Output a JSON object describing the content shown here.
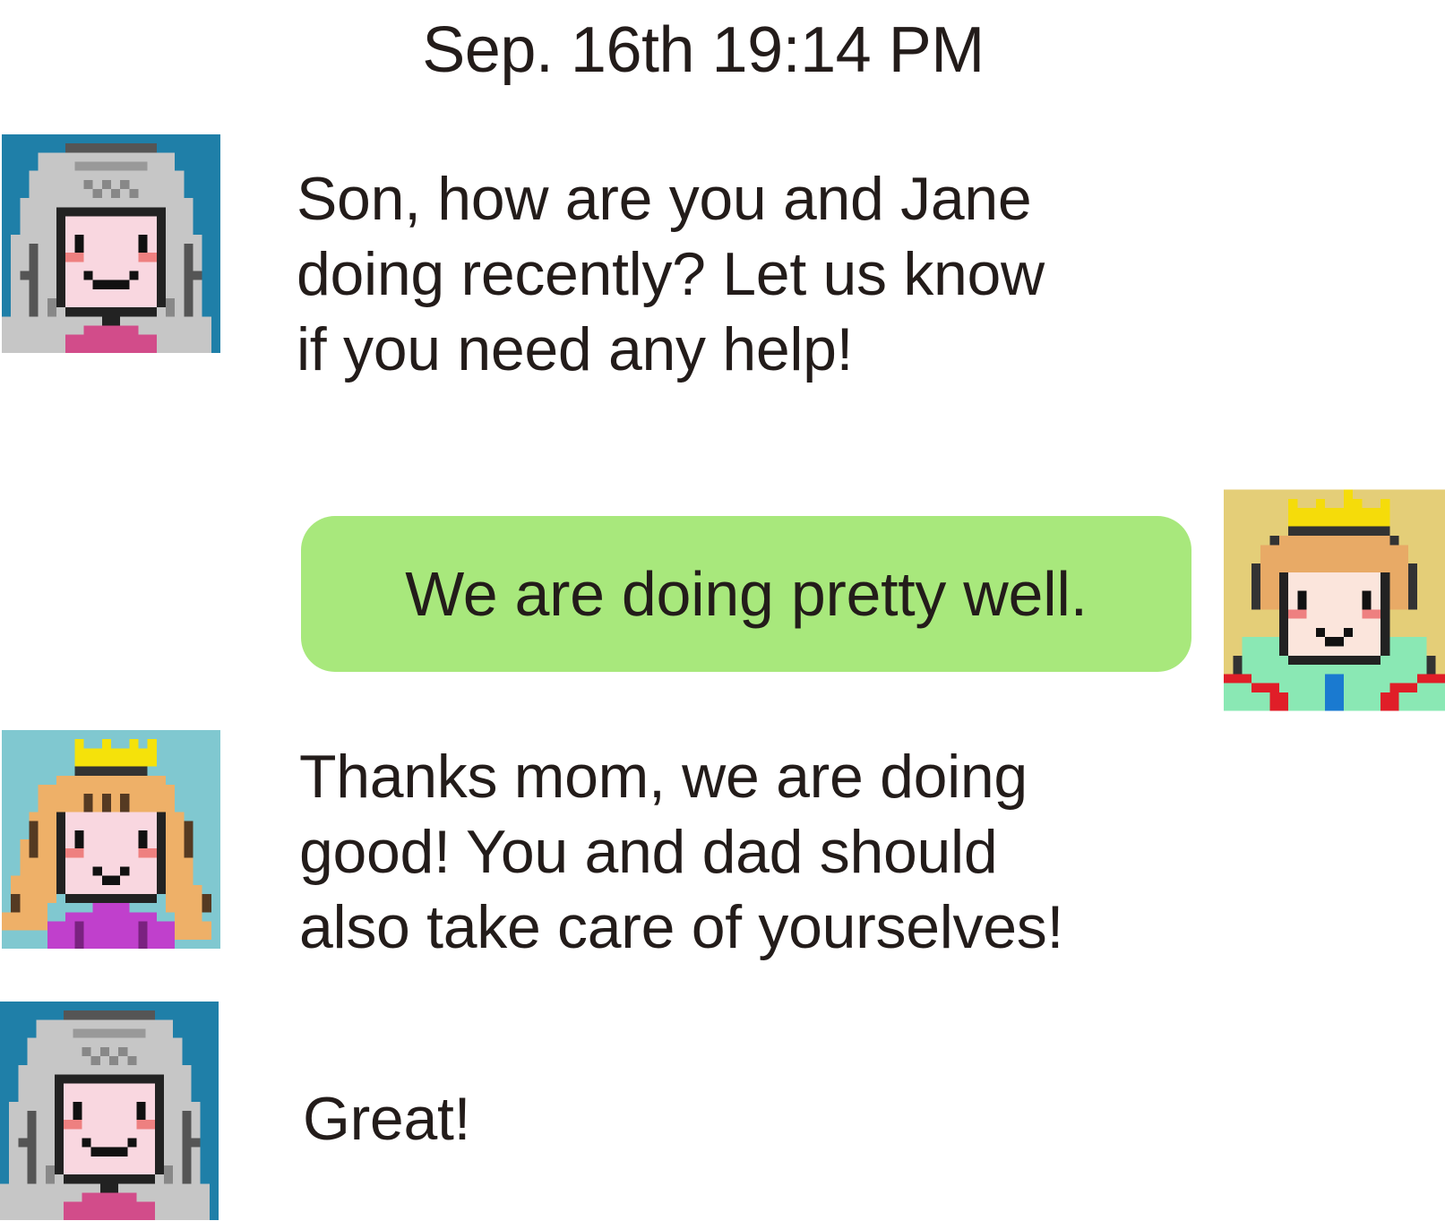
{
  "chat": {
    "timestamp": "Sep. 16th 19:14 PM",
    "messages": [
      {
        "sender": "mom",
        "side": "left",
        "lines": [
          "Son, how are you and Jane",
          "doing recently? Let us know",
          "if you need any help!"
        ]
      },
      {
        "sender": "son",
        "side": "right",
        "text": "We are doing pretty well."
      },
      {
        "sender": "jane",
        "side": "left",
        "lines": [
          "Thanks mom, we are doing",
          "good! You and dad should",
          "also take care of yourselves!"
        ]
      },
      {
        "sender": "mom",
        "side": "left",
        "text": "Great!"
      }
    ]
  },
  "avatars": {
    "mom": {
      "icon": "grandma-pixel-avatar",
      "bg": "#1f7fa8",
      "hair": "#c6c6c6",
      "face": "#f9d7e0",
      "cheek": "#ee8080",
      "dress": "#d24c8a"
    },
    "son": {
      "icon": "prince-pixel-avatar",
      "bg": "#e4ce78",
      "hair": "#e8aa66",
      "face": "#fbe5dc",
      "cheek": "#ee8080",
      "crown": "#f5dc0a",
      "cape": "#8ae8b4",
      "trim": "#e01e28",
      "tie": "#1a7ad0"
    },
    "jane": {
      "icon": "princess-pixel-avatar",
      "bg": "#80c8d0",
      "hair": "#eeb068",
      "face": "#f9d7e0",
      "cheek": "#ee8080",
      "crown": "#f5e20a",
      "dress": "#c040cc"
    }
  },
  "bubble_color": "#a8e87c"
}
